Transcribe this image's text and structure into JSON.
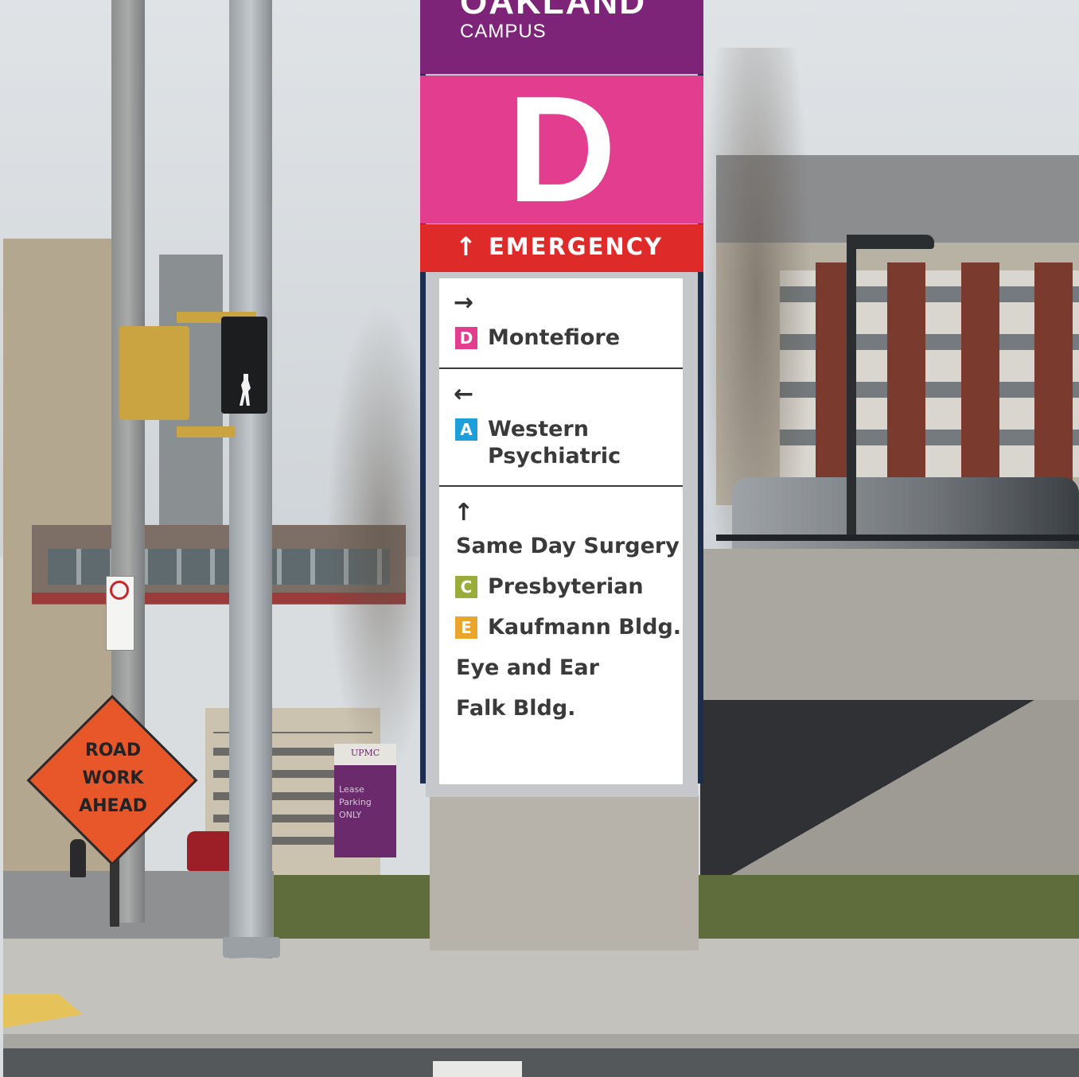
{
  "sign": {
    "campus_name": "OAKLAND",
    "campus_label": "CAMPUS",
    "building_letter": "D",
    "emergency": {
      "arrow": "↑",
      "label": "EMERGENCY"
    },
    "sections": [
      {
        "arrow": "→",
        "destinations": [
          {
            "badge": "D",
            "badge_color": "#e23d8e",
            "line1": "Montefiore"
          }
        ]
      },
      {
        "arrow": "←",
        "destinations": [
          {
            "badge": "A",
            "badge_color": "#1ba0dc",
            "line1": "Western",
            "line2": "Psychiatric"
          }
        ]
      },
      {
        "arrow": "↑",
        "destinations": [
          {
            "line1": "Same Day Surgery"
          },
          {
            "badge": "C",
            "badge_color": "#9aac3a",
            "line1": "Presbyterian"
          },
          {
            "badge": "E",
            "badge_color": "#eaa52a",
            "line1": "Kaufmann Bldg."
          },
          {
            "line1": "Eye and Ear"
          },
          {
            "line1": "Falk Bldg."
          }
        ]
      }
    ]
  },
  "road_sign": {
    "line1": "ROAD",
    "line2": "WORK",
    "line3": "AHEAD"
  },
  "parking_sign": {
    "lines": [
      "Lease",
      "Parking",
      "ONLY"
    ]
  },
  "upmc_logo": "UPMC",
  "colors": {
    "campus_band": "#7d2478",
    "letter_band": "#e23d8e",
    "emergency_band": "#df2a2a"
  }
}
